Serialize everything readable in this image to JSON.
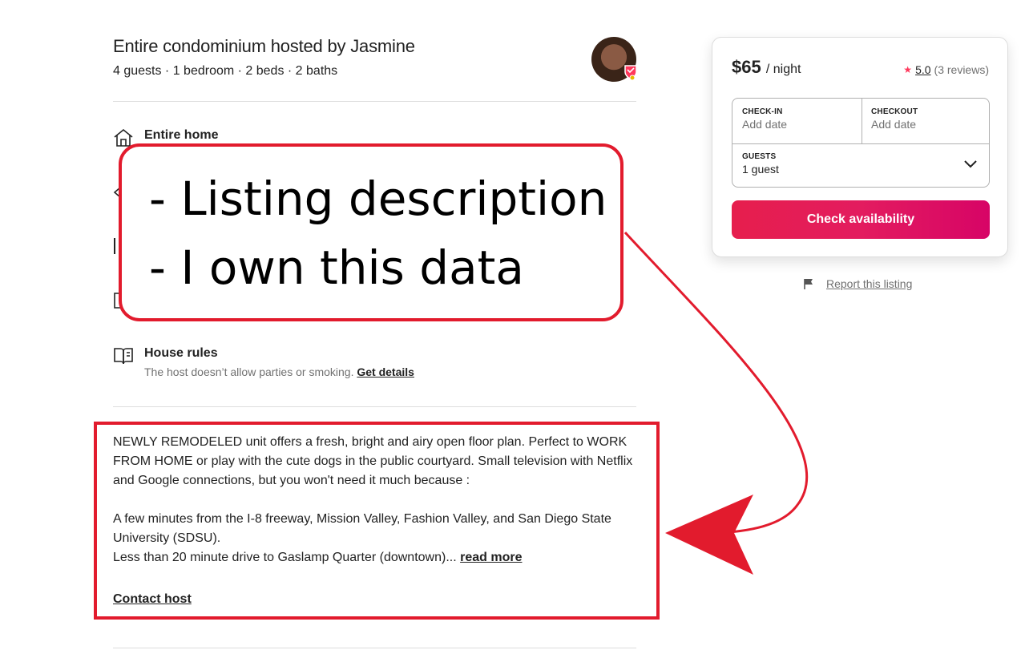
{
  "listing": {
    "title": "Entire condominium hosted by Jasmine",
    "subtitle": "4 guests · 1 bedroom · 2 beds · 2 baths"
  },
  "highlights": {
    "entire_home": {
      "title": "Entire home",
      "icon": "home-icon"
    },
    "house_rules": {
      "title": "House rules",
      "description": "The host doesn’t allow parties or smoking.",
      "link": "Get details",
      "icon": "book-icon"
    }
  },
  "description": {
    "p1": "NEWLY REMODELED unit offers a fresh, bright and airy open floor plan. Perfect to WORK FROM HOME or play with the cute dogs in the public courtyard. Small television with Netflix and Google connections, but you won't need it much because :",
    "p2": "A few minutes from the I-8 freeway, Mission Valley, Fashion Valley, and San Diego State University (SDSU).",
    "p3": "Less than 20 minute drive to Gaslamp Quarter (downtown)...",
    "read_more": "read more",
    "contact_host": "Contact host"
  },
  "booking": {
    "price": "$65",
    "per_night": "/ night",
    "rating_star": "★",
    "rating": "5.0",
    "reviews": "(3 reviews)",
    "checkin_label": "CHECK-IN",
    "checkin_value": "Add date",
    "checkout_label": "CHECKOUT",
    "checkout_value": "Add date",
    "guests_label": "GUESTS",
    "guests_value": "1 guest",
    "check_button": "Check availability",
    "report": "Report this listing"
  },
  "annotation": {
    "line1": "- Listing description",
    "line2": "- I own this data",
    "color": "#e21b2d"
  },
  "colors": {
    "brand_gradient_start": "#e61e4d",
    "brand_gradient_end": "#d70466",
    "star": "#ff385c"
  }
}
